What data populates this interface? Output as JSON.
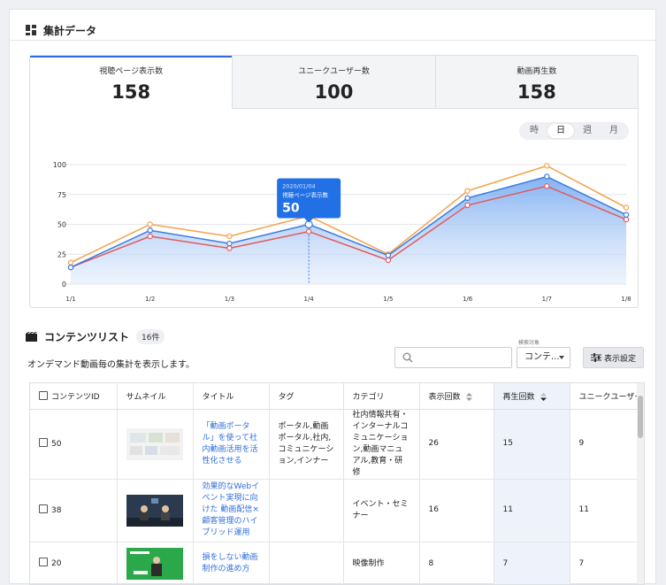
{
  "summary": {
    "title": "集計データ"
  },
  "stats": [
    {
      "label": "視聴ページ表示数",
      "value": "158"
    },
    {
      "label": "ユニークユーザー数",
      "value": "100"
    },
    {
      "label": "動画再生数",
      "value": "158"
    }
  ],
  "period": {
    "options": [
      "時",
      "日",
      "週",
      "月"
    ],
    "selected": "日"
  },
  "tooltip": {
    "date": "2020/01/04",
    "label": "視聴ページ表示数",
    "value": "50"
  },
  "colors": {
    "accent": "#2f6ddc",
    "series_blue": "#3b7be0",
    "series_orange": "#f4a24a",
    "series_red": "#e15b5b"
  },
  "chart_data": {
    "type": "line",
    "x": [
      "1/1",
      "1/2",
      "1/3",
      "1/4",
      "1/5",
      "1/6",
      "1/7",
      "1/8"
    ],
    "yticks": [
      "0",
      "25",
      "50",
      "75",
      "100"
    ],
    "ylim": [
      0,
      100
    ],
    "grid": true,
    "series": [
      {
        "color": "#f4a24a",
        "values": [
          18,
          50,
          40,
          57,
          25,
          78,
          99,
          64
        ]
      },
      {
        "color": "#3b7be0",
        "values": [
          14,
          45,
          34,
          50,
          24,
          72,
          90,
          58
        ]
      },
      {
        "color": "#e15b5b",
        "values": [
          14,
          40,
          30,
          44,
          20,
          66,
          82,
          54
        ]
      }
    ]
  },
  "contents": {
    "title": "コンテンツリスト",
    "count_badge": "16件",
    "description": "オンデマンド動画毎の集計を表示します。",
    "search_target_label": "検索対象",
    "search_placeholder": "",
    "select_value": "コンテ...",
    "settings_button": "表示設定",
    "columns": [
      "コンテンツID",
      "サムネイル",
      "タイトル",
      "タグ",
      "カテゴリ",
      "表示回数",
      "再生回数",
      "ユニークユーザー"
    ],
    "rows": [
      {
        "id": "50",
        "title": "「動画ポータル」を使って社内動画活用を活性化させる",
        "tags": "ポータル,動画ポータル,社内,コミュニケーション,インナー",
        "category": "社内情報共有・インターナルコミュニケーション,動画マニュアル,教育・研修",
        "views": "26",
        "plays": "15",
        "uu": "9"
      },
      {
        "id": "38",
        "title": "効果的なWebイベント実現に向けた 動画配信×顧客管理のハイブリッド運用",
        "tags": "",
        "category": "イベント・セミナー",
        "views": "16",
        "plays": "11",
        "uu": "11"
      },
      {
        "id": "20",
        "title": "損をしない動画制作の進め方",
        "tags": "",
        "category": "映像制作",
        "views": "8",
        "plays": "7",
        "uu": "7"
      }
    ]
  }
}
